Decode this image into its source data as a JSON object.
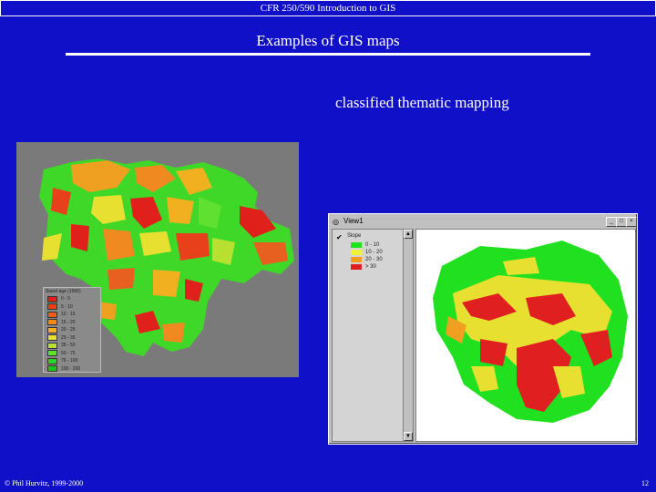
{
  "header": {
    "course": "CFR 250/590 Introduction to GIS"
  },
  "slide": {
    "title": "Examples of GIS maps",
    "subtitle": "classified thematic mapping"
  },
  "left_map": {
    "legend_title": "Stand age (1996)",
    "legend_items": [
      {
        "label": "0 - 5",
        "color": "#e0201a"
      },
      {
        "label": "5 - 10",
        "color": "#e8401a"
      },
      {
        "label": "10 - 15",
        "color": "#e86020"
      },
      {
        "label": "15 - 20",
        "color": "#f08a20"
      },
      {
        "label": "20 - 25",
        "color": "#f0b020"
      },
      {
        "label": "25 - 35",
        "color": "#e8e030"
      },
      {
        "label": "35 - 50",
        "color": "#b8e030"
      },
      {
        "label": "50 - 75",
        "color": "#60e030"
      },
      {
        "label": "75 - 100",
        "color": "#30d030"
      },
      {
        "label": "100 - 200",
        "color": "#20c020"
      }
    ]
  },
  "gis_window": {
    "title": "View1",
    "theme_name": "Slope",
    "classes": [
      {
        "label": "0 - 10",
        "color": "#20e020"
      },
      {
        "label": "10 - 20",
        "color": "#f0f040"
      },
      {
        "label": "20 - 30",
        "color": "#f0a020"
      },
      {
        "label": "> 30",
        "color": "#e02020"
      }
    ]
  },
  "footer": {
    "copyright": "© Phil Hurvitz, 1999-2000",
    "page_number": "12"
  }
}
